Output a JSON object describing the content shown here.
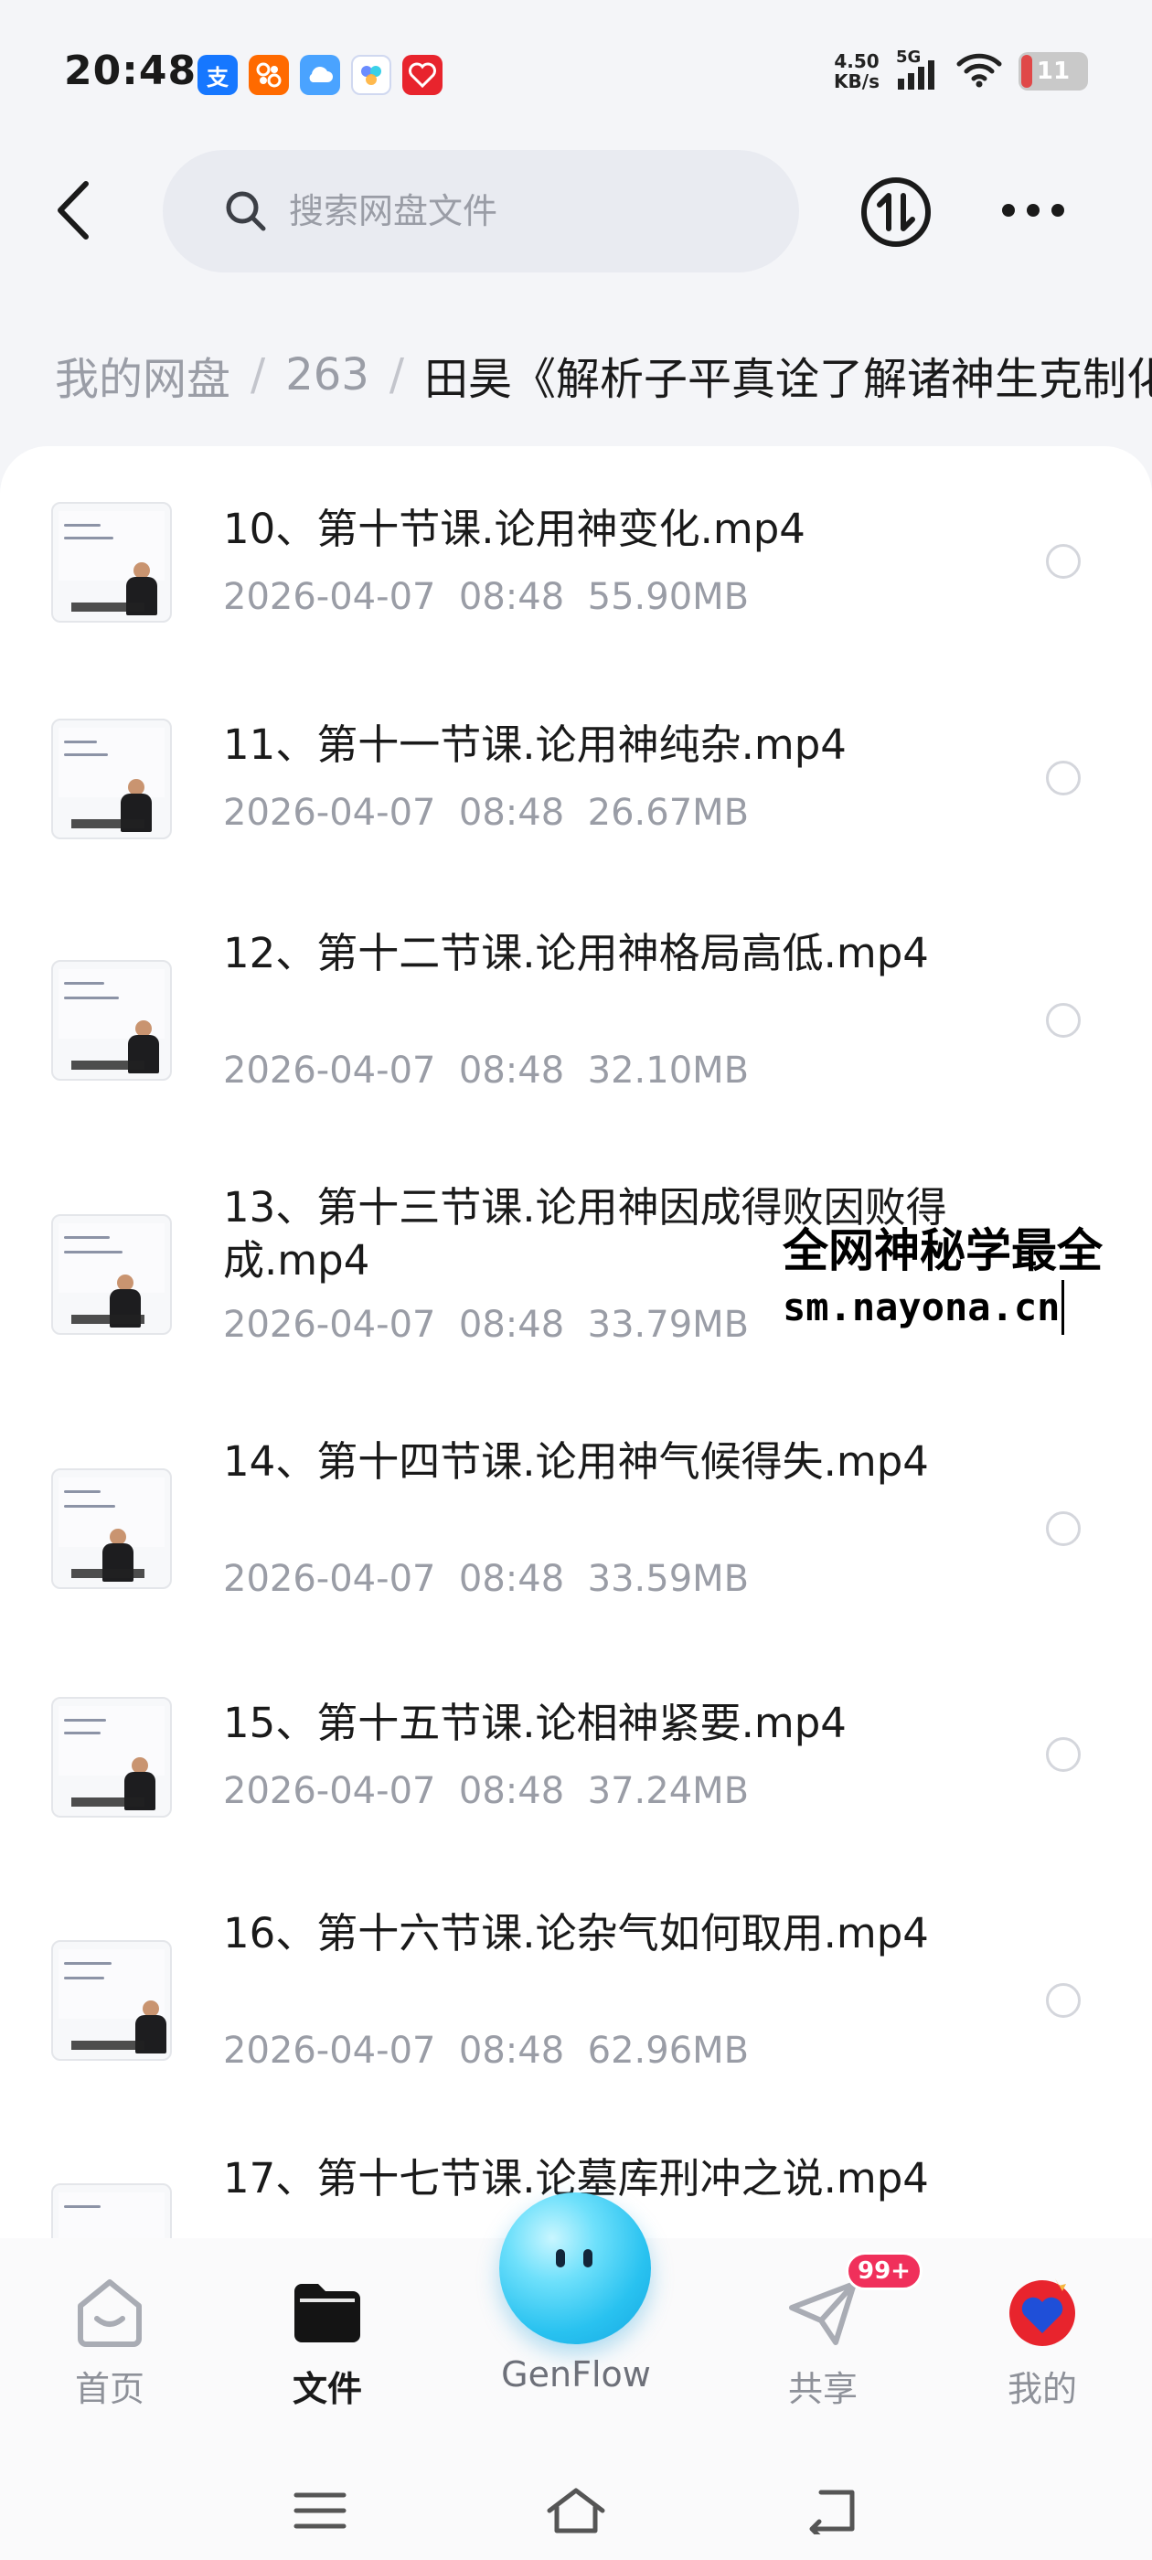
{
  "status_bar": {
    "time": "20:48",
    "apps": [
      {
        "icon": "alipay-icon",
        "glyph": "支",
        "color": "#1677ff"
      },
      {
        "icon": "taobao-app-icon",
        "glyph": "8",
        "color": "#ff6a00"
      },
      {
        "icon": "cloud-app-icon",
        "glyph": "☁",
        "color": "#4aa3ff"
      },
      {
        "icon": "genflow-app-icon",
        "glyph": "✿",
        "color": "#6a8cff"
      },
      {
        "icon": "red-app-icon",
        "glyph": "❤",
        "color": "#e8242d"
      }
    ],
    "net_speed_value": "4.50",
    "net_speed_unit": "KB/s",
    "network": "5G",
    "battery": "11"
  },
  "header": {
    "search_placeholder": "搜索网盘文件"
  },
  "breadcrumb": {
    "root": "我的网盘",
    "folder": "263",
    "current": "田昊《解析子平真诠了解诸神生克制化》"
  },
  "files": [
    {
      "name": "10、第十节课.论用神变化.mp4",
      "date": "2026-04-07",
      "time": "08:48",
      "size": "55.90MB"
    },
    {
      "name": "11、第十一节课.论用神纯杂.mp4",
      "date": "2026-04-07",
      "time": "08:48",
      "size": "26.67MB"
    },
    {
      "name": "12、第十二节课.论用神格局高低.mp4",
      "date": "2026-04-07",
      "time": "08:48",
      "size": "32.10MB"
    },
    {
      "name": "13、第十三节课.论用神因成得败因败得成.mp4",
      "date": "2026-04-07",
      "time": "08:48",
      "size": "33.79MB"
    },
    {
      "name": "14、第十四节课.论用神气候得失.mp4",
      "date": "2026-04-07",
      "time": "08:48",
      "size": "33.59MB"
    },
    {
      "name": "15、第十五节课.论相神紧要.mp4",
      "date": "2026-04-07",
      "time": "08:48",
      "size": "37.24MB"
    },
    {
      "name": "16、第十六节课.论杂气如何取用.mp4",
      "date": "2026-04-07",
      "time": "08:48",
      "size": "62.96MB"
    },
    {
      "name": "17、第十七节课.论墓库刑冲之说.mp4",
      "date": "",
      "time": "",
      "size": ""
    }
  ],
  "watermark": {
    "line1": "全网神秘学最全",
    "line2": "sm.nayona.cn"
  },
  "bottom_nav": {
    "home": "首页",
    "files": "文件",
    "genflow": "GenFlow",
    "share": "共享",
    "share_badge": "99+",
    "mine": "我的"
  },
  "colors": {
    "accent_active": "#1a1a1a",
    "muted_text": "#9a9da6",
    "badge": "#f0305b",
    "genflow_orb": "#29c2f0"
  }
}
